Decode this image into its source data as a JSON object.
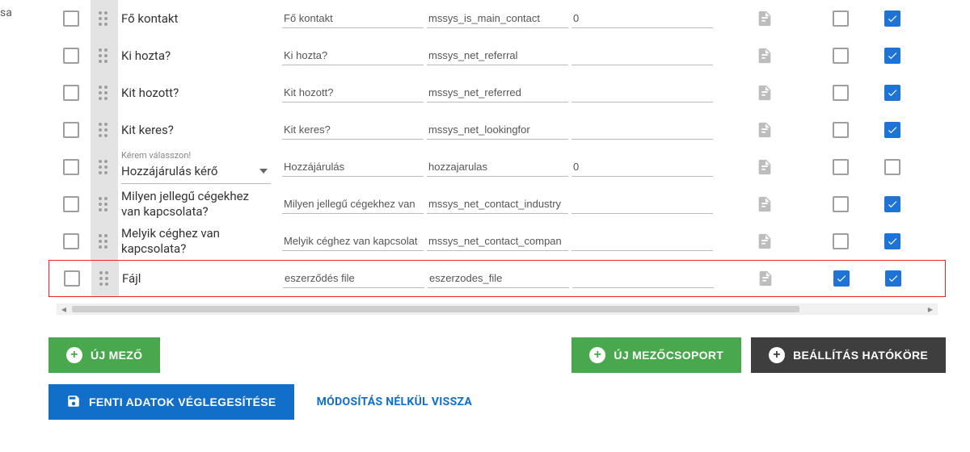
{
  "stray_text": "sa",
  "rows": [
    {
      "label": "Fő kontakt",
      "helper": "",
      "dropdown": false,
      "col2": "Fő kontakt",
      "col3": "mssys_is_main_contact",
      "col4": "0",
      "cb2": false,
      "cb3": true,
      "highlight": false
    },
    {
      "label": "Ki hozta?",
      "helper": "",
      "dropdown": false,
      "col2": "Ki hozta?",
      "col3": "mssys_net_referral",
      "col4": "",
      "cb2": false,
      "cb3": true,
      "highlight": false
    },
    {
      "label": "Kit hozott?",
      "helper": "",
      "dropdown": false,
      "col2": "Kit hozott?",
      "col3": "mssys_net_referred",
      "col4": "",
      "cb2": false,
      "cb3": true,
      "highlight": false
    },
    {
      "label": "Kit keres?",
      "helper": "",
      "dropdown": false,
      "col2": "Kit keres?",
      "col3": "mssys_net_lookingfor",
      "col4": "",
      "cb2": false,
      "cb3": true,
      "highlight": false
    },
    {
      "label": "Hozzájárulás kérő",
      "helper": "Kérem válasszon!",
      "dropdown": true,
      "col2": "Hozzájárulás",
      "col3": "hozzajarulas",
      "col4": "0",
      "cb2": false,
      "cb3": false,
      "highlight": false
    },
    {
      "label": "Milyen jellegű cégekhez van kapcsolata?",
      "helper": "",
      "dropdown": false,
      "col2": "Milyen jellegű cégekhez van",
      "col3": "mssys_net_contact_industry",
      "col4": "",
      "cb2": false,
      "cb3": true,
      "highlight": false
    },
    {
      "label": "Melyik céghez van kapcsolata?",
      "helper": "",
      "dropdown": false,
      "col2": "Melyik céghez van kapcsolat",
      "col3": "mssys_net_contact_compan",
      "col4": "",
      "cb2": false,
      "cb3": true,
      "highlight": false
    },
    {
      "label": "Fájl",
      "helper": "",
      "dropdown": false,
      "col2": "eszerződés file",
      "col3": "eszerzodes_file",
      "col4": "",
      "cb2": true,
      "cb3": true,
      "highlight": true
    }
  ],
  "buttons": {
    "new_field": "ÚJ MEZŐ",
    "new_group": "ÚJ MEZŐCSOPORT",
    "scope": "BEÁLLÍTÁS HATÓKÖRE",
    "finalize": "FENTI ADATOK VÉGLEGESÍTÉSE",
    "back": "MÓDOSÍTÁS NÉLKÜL VISSZA"
  }
}
